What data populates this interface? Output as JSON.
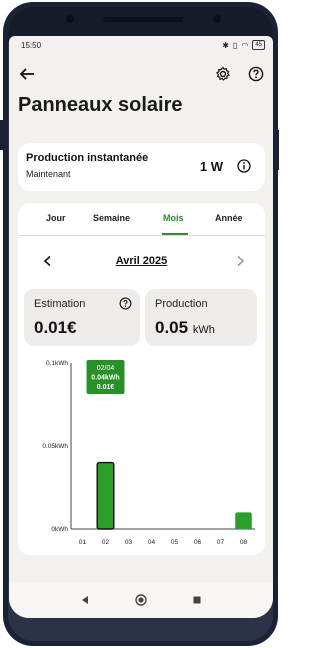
{
  "status": {
    "time": "15:50",
    "battery": "45"
  },
  "page": {
    "title": "Panneaux solaire"
  },
  "production": {
    "title": "Production instantanée",
    "subtitle": "Maintenant",
    "value": "1 W"
  },
  "tabs": [
    {
      "label": "Jour"
    },
    {
      "label": "Semaine"
    },
    {
      "label": "Mois"
    },
    {
      "label": "Année"
    }
  ],
  "active_tab": "Mois",
  "month": {
    "label": "Avril 2025"
  },
  "estimation": {
    "label": "Estimation",
    "value": "0.01€"
  },
  "production_stat": {
    "label": "Production",
    "value": "0.05",
    "unit": "kWh"
  },
  "colors": {
    "accent": "#2e8b2e",
    "bar": "#2aa12a",
    "background": "#f3f1ee"
  },
  "chart_data": {
    "type": "bar",
    "categories": [
      "01",
      "02",
      "03",
      "04",
      "05",
      "06",
      "07",
      "08"
    ],
    "values": [
      0,
      0.04,
      0,
      0,
      0,
      0,
      0,
      0.01
    ],
    "ylim": [
      0,
      0.1
    ],
    "yticks": [
      "0kWh",
      "0.05kWh",
      "0.1kWh"
    ],
    "ytick_values": [
      0,
      0.05,
      0.1
    ],
    "tooltip": {
      "line1": "02/04",
      "line2": "0.04kWh",
      "line3": "0.01€"
    },
    "selected_index": 1
  }
}
